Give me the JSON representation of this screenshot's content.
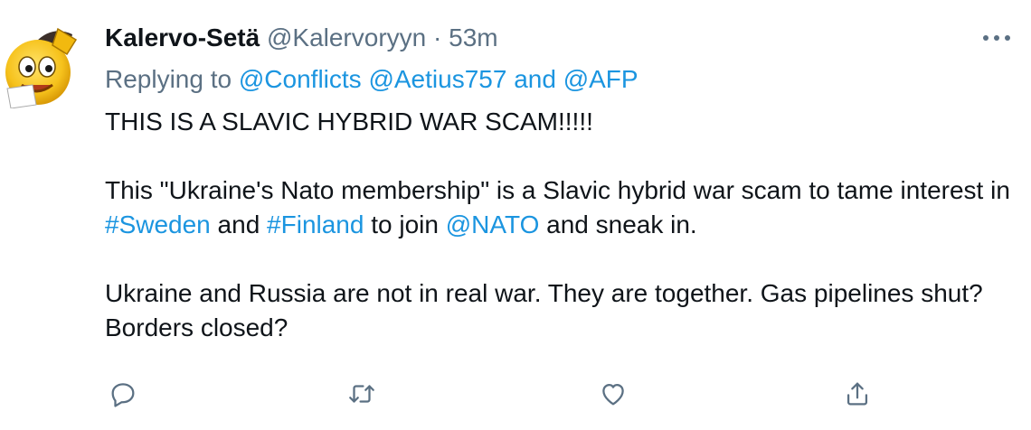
{
  "tweet": {
    "author": {
      "display_name": "Kalervo-Setä",
      "handle": "@Kalervoryyn",
      "separator": "·",
      "timestamp": "53m",
      "avatar_icon": "emoji-saluting-face-icon"
    },
    "more_icon": "more-horizontal-icon",
    "replying_to": {
      "prefix": "Replying to",
      "mention_1": "@Conflicts",
      "mention_2": "@Aetius757",
      "conjunction": "and",
      "mention_3": "@AFP"
    },
    "body": {
      "p1": "THIS IS A SLAVIC HYBRID WAR SCAM!!!!!",
      "p2_text_1": "This \"Ukraine's Nato membership\" is a Slavic hybrid war scam to tame interest in",
      "p2_hashtag_1": "#Sweden",
      "p2_text_2": "and",
      "p2_hashtag_2": "#Finland",
      "p2_text_3": "to join",
      "p2_mention": "@NATO",
      "p2_text_4": "and sneak in.",
      "p3": "Ukraine and Russia are not in real war. They are together. Gas pipelines shut? Borders closed?"
    },
    "actions": [
      {
        "name": "reply",
        "icon": "reply-icon"
      },
      {
        "name": "retweet",
        "icon": "retweet-icon"
      },
      {
        "name": "like",
        "icon": "heart-icon"
      },
      {
        "name": "share",
        "icon": "share-icon"
      }
    ],
    "colors": {
      "text": "#0f1419",
      "secondary": "#5b7083",
      "link": "#1b95e0",
      "action_icon": "#5b7083"
    }
  }
}
